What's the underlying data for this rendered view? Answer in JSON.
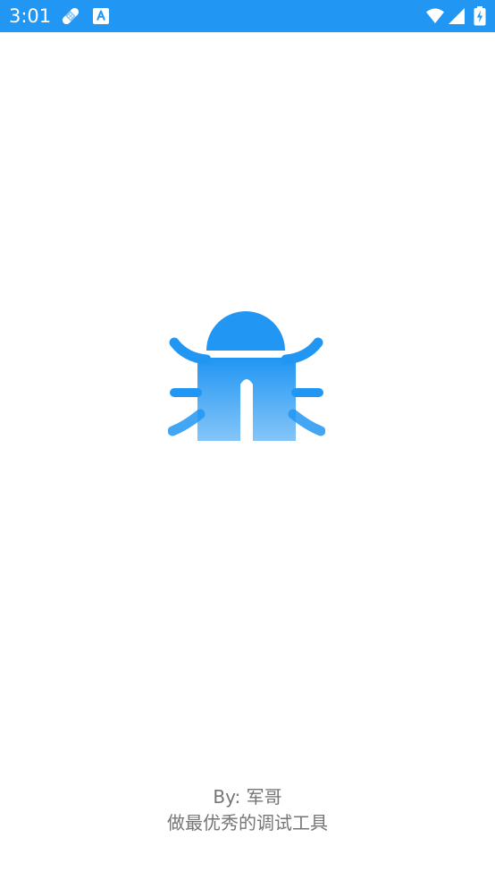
{
  "status_bar": {
    "time": "3:01",
    "background_color": "#2196f3",
    "icons": {
      "left": [
        "bandage-icon",
        "font-a-icon"
      ],
      "right": [
        "wifi-icon",
        "cellular-signal-icon",
        "battery-charging-icon"
      ]
    }
  },
  "splash": {
    "logo_icon": "bug-icon",
    "logo_color": "#2196f3",
    "author": "By: 军哥",
    "slogan": "做最优秀的调试工具",
    "text_color": "#757575"
  }
}
